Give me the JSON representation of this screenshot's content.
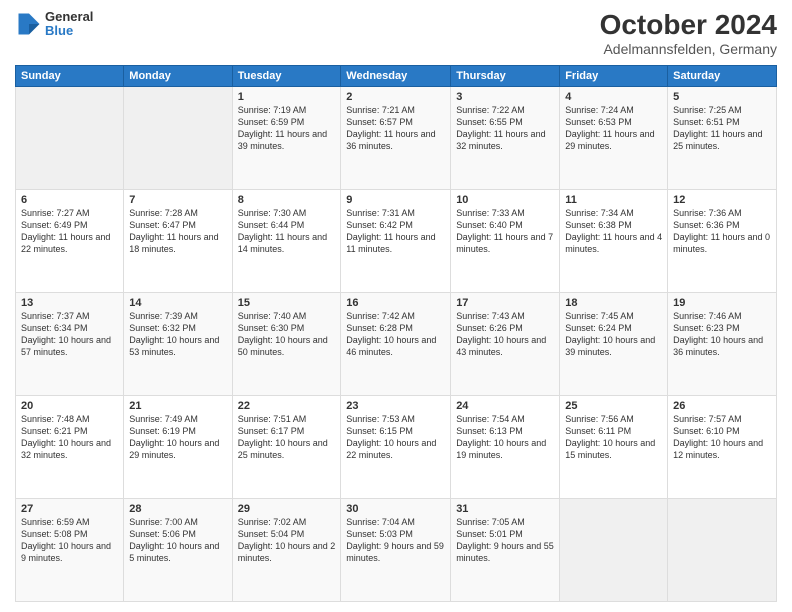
{
  "logo": {
    "line1": "General",
    "line2": "Blue"
  },
  "title": "October 2024",
  "subtitle": "Adelmannsfelden, Germany",
  "days_of_week": [
    "Sunday",
    "Monday",
    "Tuesday",
    "Wednesday",
    "Thursday",
    "Friday",
    "Saturday"
  ],
  "weeks": [
    [
      {
        "day": "",
        "sunrise": "",
        "sunset": "",
        "daylight": ""
      },
      {
        "day": "",
        "sunrise": "",
        "sunset": "",
        "daylight": ""
      },
      {
        "day": "1",
        "sunrise": "Sunrise: 7:19 AM",
        "sunset": "Sunset: 6:59 PM",
        "daylight": "Daylight: 11 hours and 39 minutes."
      },
      {
        "day": "2",
        "sunrise": "Sunrise: 7:21 AM",
        "sunset": "Sunset: 6:57 PM",
        "daylight": "Daylight: 11 hours and 36 minutes."
      },
      {
        "day": "3",
        "sunrise": "Sunrise: 7:22 AM",
        "sunset": "Sunset: 6:55 PM",
        "daylight": "Daylight: 11 hours and 32 minutes."
      },
      {
        "day": "4",
        "sunrise": "Sunrise: 7:24 AM",
        "sunset": "Sunset: 6:53 PM",
        "daylight": "Daylight: 11 hours and 29 minutes."
      },
      {
        "day": "5",
        "sunrise": "Sunrise: 7:25 AM",
        "sunset": "Sunset: 6:51 PM",
        "daylight": "Daylight: 11 hours and 25 minutes."
      }
    ],
    [
      {
        "day": "6",
        "sunrise": "Sunrise: 7:27 AM",
        "sunset": "Sunset: 6:49 PM",
        "daylight": "Daylight: 11 hours and 22 minutes."
      },
      {
        "day": "7",
        "sunrise": "Sunrise: 7:28 AM",
        "sunset": "Sunset: 6:47 PM",
        "daylight": "Daylight: 11 hours and 18 minutes."
      },
      {
        "day": "8",
        "sunrise": "Sunrise: 7:30 AM",
        "sunset": "Sunset: 6:44 PM",
        "daylight": "Daylight: 11 hours and 14 minutes."
      },
      {
        "day": "9",
        "sunrise": "Sunrise: 7:31 AM",
        "sunset": "Sunset: 6:42 PM",
        "daylight": "Daylight: 11 hours and 11 minutes."
      },
      {
        "day": "10",
        "sunrise": "Sunrise: 7:33 AM",
        "sunset": "Sunset: 6:40 PM",
        "daylight": "Daylight: 11 hours and 7 minutes."
      },
      {
        "day": "11",
        "sunrise": "Sunrise: 7:34 AM",
        "sunset": "Sunset: 6:38 PM",
        "daylight": "Daylight: 11 hours and 4 minutes."
      },
      {
        "day": "12",
        "sunrise": "Sunrise: 7:36 AM",
        "sunset": "Sunset: 6:36 PM",
        "daylight": "Daylight: 11 hours and 0 minutes."
      }
    ],
    [
      {
        "day": "13",
        "sunrise": "Sunrise: 7:37 AM",
        "sunset": "Sunset: 6:34 PM",
        "daylight": "Daylight: 10 hours and 57 minutes."
      },
      {
        "day": "14",
        "sunrise": "Sunrise: 7:39 AM",
        "sunset": "Sunset: 6:32 PM",
        "daylight": "Daylight: 10 hours and 53 minutes."
      },
      {
        "day": "15",
        "sunrise": "Sunrise: 7:40 AM",
        "sunset": "Sunset: 6:30 PM",
        "daylight": "Daylight: 10 hours and 50 minutes."
      },
      {
        "day": "16",
        "sunrise": "Sunrise: 7:42 AM",
        "sunset": "Sunset: 6:28 PM",
        "daylight": "Daylight: 10 hours and 46 minutes."
      },
      {
        "day": "17",
        "sunrise": "Sunrise: 7:43 AM",
        "sunset": "Sunset: 6:26 PM",
        "daylight": "Daylight: 10 hours and 43 minutes."
      },
      {
        "day": "18",
        "sunrise": "Sunrise: 7:45 AM",
        "sunset": "Sunset: 6:24 PM",
        "daylight": "Daylight: 10 hours and 39 minutes."
      },
      {
        "day": "19",
        "sunrise": "Sunrise: 7:46 AM",
        "sunset": "Sunset: 6:23 PM",
        "daylight": "Daylight: 10 hours and 36 minutes."
      }
    ],
    [
      {
        "day": "20",
        "sunrise": "Sunrise: 7:48 AM",
        "sunset": "Sunset: 6:21 PM",
        "daylight": "Daylight: 10 hours and 32 minutes."
      },
      {
        "day": "21",
        "sunrise": "Sunrise: 7:49 AM",
        "sunset": "Sunset: 6:19 PM",
        "daylight": "Daylight: 10 hours and 29 minutes."
      },
      {
        "day": "22",
        "sunrise": "Sunrise: 7:51 AM",
        "sunset": "Sunset: 6:17 PM",
        "daylight": "Daylight: 10 hours and 25 minutes."
      },
      {
        "day": "23",
        "sunrise": "Sunrise: 7:53 AM",
        "sunset": "Sunset: 6:15 PM",
        "daylight": "Daylight: 10 hours and 22 minutes."
      },
      {
        "day": "24",
        "sunrise": "Sunrise: 7:54 AM",
        "sunset": "Sunset: 6:13 PM",
        "daylight": "Daylight: 10 hours and 19 minutes."
      },
      {
        "day": "25",
        "sunrise": "Sunrise: 7:56 AM",
        "sunset": "Sunset: 6:11 PM",
        "daylight": "Daylight: 10 hours and 15 minutes."
      },
      {
        "day": "26",
        "sunrise": "Sunrise: 7:57 AM",
        "sunset": "Sunset: 6:10 PM",
        "daylight": "Daylight: 10 hours and 12 minutes."
      }
    ],
    [
      {
        "day": "27",
        "sunrise": "Sunrise: 6:59 AM",
        "sunset": "Sunset: 5:08 PM",
        "daylight": "Daylight: 10 hours and 9 minutes."
      },
      {
        "day": "28",
        "sunrise": "Sunrise: 7:00 AM",
        "sunset": "Sunset: 5:06 PM",
        "daylight": "Daylight: 10 hours and 5 minutes."
      },
      {
        "day": "29",
        "sunrise": "Sunrise: 7:02 AM",
        "sunset": "Sunset: 5:04 PM",
        "daylight": "Daylight: 10 hours and 2 minutes."
      },
      {
        "day": "30",
        "sunrise": "Sunrise: 7:04 AM",
        "sunset": "Sunset: 5:03 PM",
        "daylight": "Daylight: 9 hours and 59 minutes."
      },
      {
        "day": "31",
        "sunrise": "Sunrise: 7:05 AM",
        "sunset": "Sunset: 5:01 PM",
        "daylight": "Daylight: 9 hours and 55 minutes."
      },
      {
        "day": "",
        "sunrise": "",
        "sunset": "",
        "daylight": ""
      },
      {
        "day": "",
        "sunrise": "",
        "sunset": "",
        "daylight": ""
      }
    ]
  ]
}
